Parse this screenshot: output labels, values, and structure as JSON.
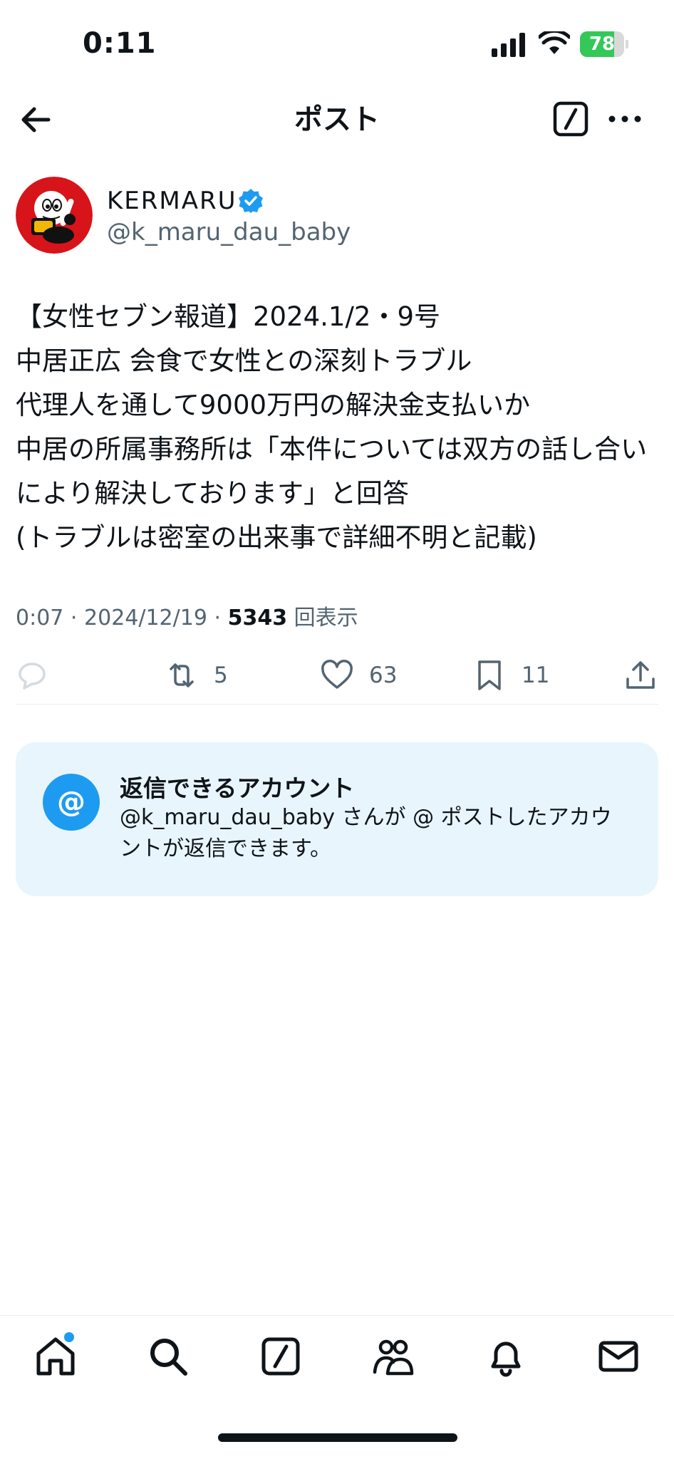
{
  "status_bar": {
    "time": "0:11",
    "battery_level": "78",
    "battery_percent": 78,
    "battery_color": "#34c759"
  },
  "nav": {
    "title": "ポスト",
    "back_icon": "arrow-left-icon",
    "compose_icon": "compose-icon",
    "more_icon": "more-horizontal-icon"
  },
  "author": {
    "display_name": "KERMARU",
    "handle": "@k_maru_dau_baby",
    "verified": true,
    "verified_color": "#1d9bf0"
  },
  "post": {
    "text": "【女性セブン報道】2024.1/2・9号\n中居正広 会食で女性との深刻トラブル\n代理人を通して9000万円の解決金支払いか\n中居の所属事務所は「本件については双方の話し合いにより解決しております」と回答\n(トラブルは密室の出来事で詳細不明と記載)",
    "time": "0:07",
    "date": "2024/12/19",
    "separator": "·",
    "views": "5343",
    "views_label": "回表示"
  },
  "actions": {
    "reply_count": "",
    "repost_count": "5",
    "like_count": "63",
    "bookmark_count": "11"
  },
  "reply_restriction": {
    "icon_text": "@",
    "title": "返信できるアカウント",
    "description": "@k_maru_dau_baby さんが @ ポストしたアカウントが返信できます。"
  },
  "tabbar": {
    "items": [
      "home-icon",
      "search-icon",
      "compose-icon",
      "communities-icon",
      "bell-icon",
      "mail-icon"
    ],
    "notification_dot_color": "#1d9bf0"
  }
}
